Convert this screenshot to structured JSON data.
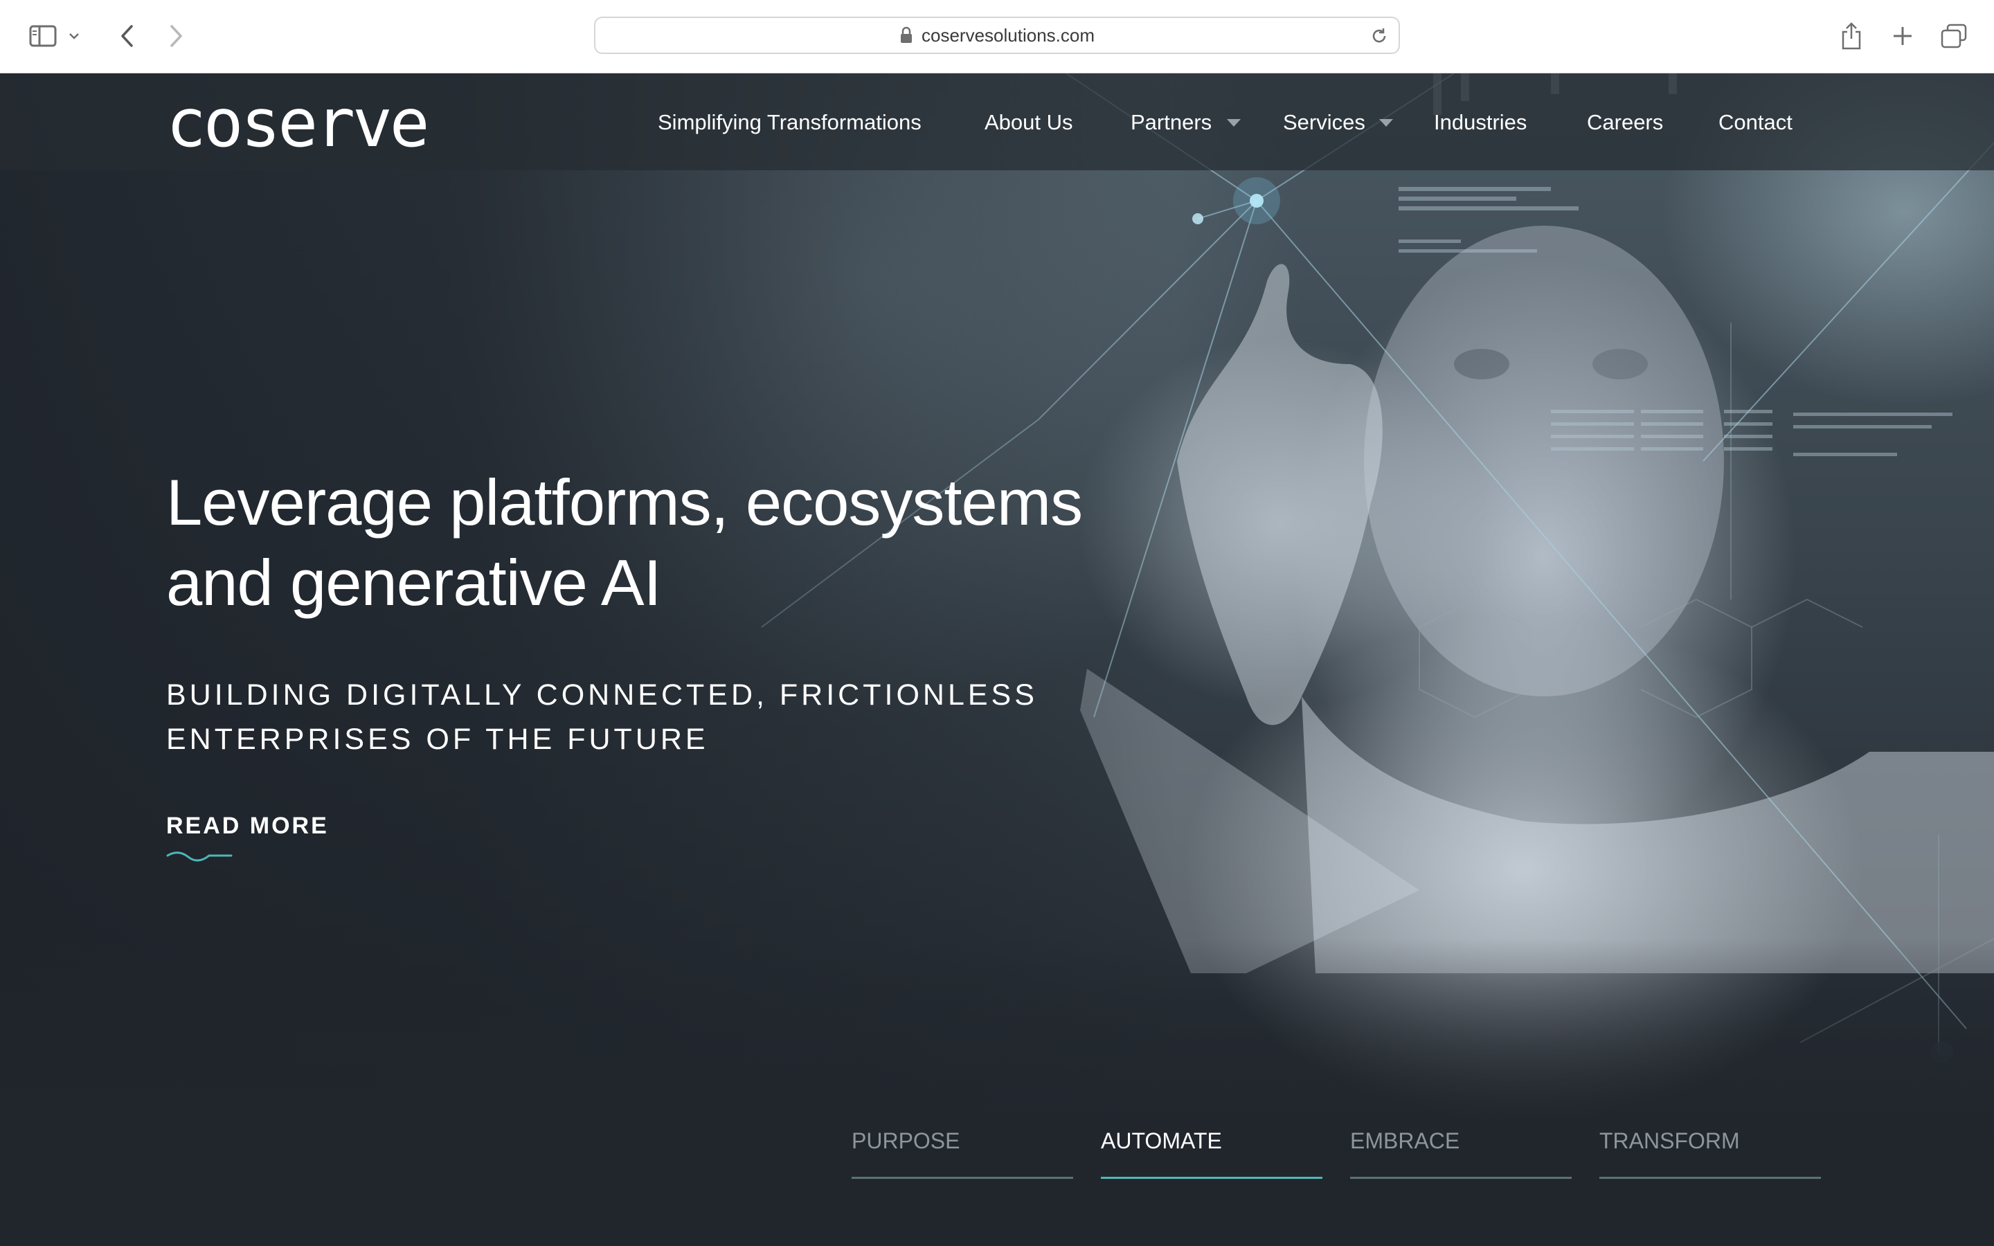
{
  "browser": {
    "url": "coservesolutions.com",
    "icons": [
      "sidebar-icon",
      "chevron-down-icon",
      "back-icon",
      "forward-icon",
      "lock-icon",
      "reload-icon",
      "share-icon",
      "new-tab-icon",
      "tabs-overview-icon"
    ]
  },
  "site": {
    "logo": "coserve",
    "nav": [
      {
        "label": "Simplifying Transformations",
        "dropdown": false
      },
      {
        "label": "About Us",
        "dropdown": false
      },
      {
        "label": "Partners",
        "dropdown": true
      },
      {
        "label": "Services",
        "dropdown": true
      },
      {
        "label": "Industries",
        "dropdown": false
      },
      {
        "label": "Careers",
        "dropdown": false
      },
      {
        "label": "Contact",
        "dropdown": false
      }
    ]
  },
  "hero": {
    "headline_line1": "Leverage platforms, ecosystems",
    "headline_line2": "and generative AI",
    "subhead_line1": "BUILDING DIGITALLY CONNECTED, FRICTIONLESS",
    "subhead_line2": "ENTERPRISES OF THE FUTURE",
    "cta": "READ MORE"
  },
  "tabs": [
    {
      "label": "PURPOSE",
      "active": false
    },
    {
      "label": "AUTOMATE",
      "active": true
    },
    {
      "label": "EMBRACE",
      "active": false
    },
    {
      "label": "TRANSFORM",
      "active": false
    }
  ],
  "colors": {
    "accent": "#4fb7b8",
    "header_bg": "#262c32",
    "hero_dark": "#20252b"
  }
}
